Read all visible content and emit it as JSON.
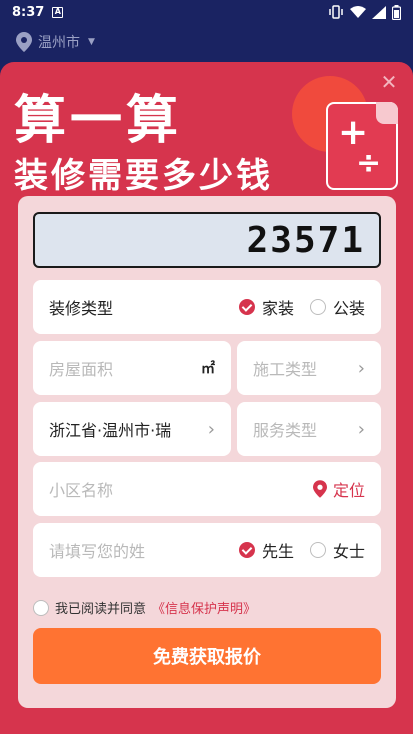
{
  "status_bar": {
    "time": "8:37",
    "notif_icon": "A"
  },
  "location": {
    "city": "温州市"
  },
  "hero": {
    "title_line1": "算一算",
    "title_line2": "装修需要多少钱",
    "doc_plus": "+",
    "doc_divide": "÷"
  },
  "calculator": {
    "display_value": "23571"
  },
  "form": {
    "decor_type": {
      "label": "装修类型",
      "options": [
        "家装",
        "公装"
      ],
      "selected": "家装"
    },
    "area": {
      "placeholder": "房屋面积",
      "unit": "㎡"
    },
    "construction_type": {
      "placeholder": "施工类型"
    },
    "region": {
      "value": "浙江省·温州市·瑞"
    },
    "service_type": {
      "placeholder": "服务类型"
    },
    "community": {
      "placeholder": "小区名称",
      "locate_label": "定位"
    },
    "surname": {
      "placeholder": "请填写您的姓",
      "options": [
        "先生",
        "女士"
      ],
      "selected": "先生"
    }
  },
  "agreement": {
    "prefix": "我已阅读并同意",
    "link": "《信息保护声明》"
  },
  "submit_label": "免费获取报价",
  "colors": {
    "brand_red": "#d6344d",
    "cta_orange": "#ff7332",
    "dark_bg": "#1a2362"
  }
}
